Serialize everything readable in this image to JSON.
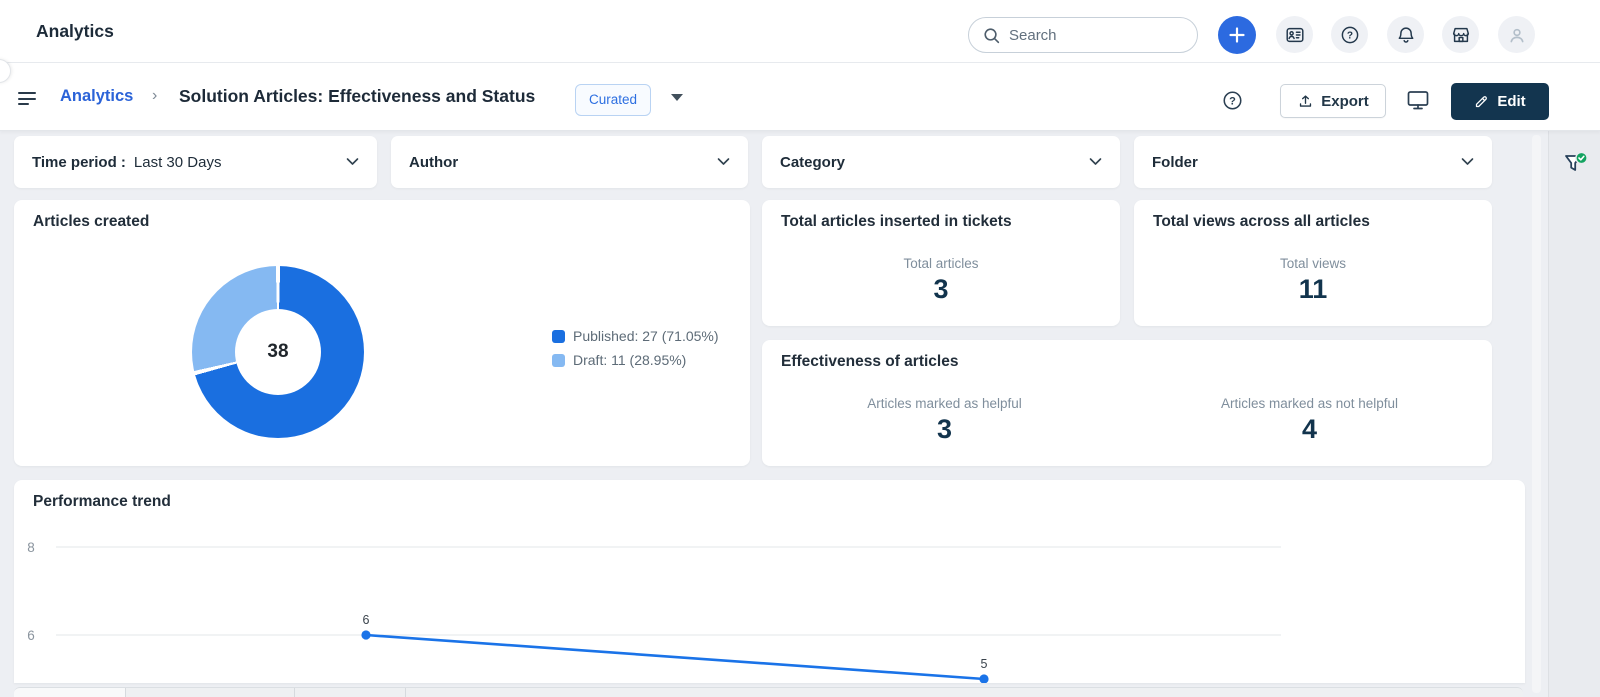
{
  "topbar": {
    "app_title": "Analytics",
    "search_placeholder": "Search"
  },
  "breadcrumb": {
    "section": "Analytics",
    "separator": "›",
    "title": "Solution Articles: Effectiveness and Status",
    "badge": "Curated"
  },
  "toolbar": {
    "export_label": "Export",
    "edit_label": "Edit"
  },
  "filters": {
    "items": [
      {
        "label": "Time period :",
        "value": "Last 30 Days"
      },
      {
        "label": "Author"
      },
      {
        "label": "Category"
      },
      {
        "label": "Folder"
      }
    ]
  },
  "widgets": {
    "articles_created": {
      "title": "Articles created"
    },
    "inserted": {
      "title": "Total articles inserted in tickets",
      "metric_label": "Total articles",
      "value": "3"
    },
    "views": {
      "title": "Total views across all articles",
      "metric_label": "Total views",
      "value": "11"
    },
    "effectiveness": {
      "title": "Effectiveness of articles",
      "stats": [
        {
          "label": "Articles marked as helpful",
          "value": "3"
        },
        {
          "label": "Articles marked as not helpful",
          "value": "4"
        }
      ]
    },
    "performance": {
      "title": "Performance trend"
    }
  },
  "chart_data": [
    {
      "id": "articles-created",
      "type": "pie",
      "subtype": "donut",
      "title": "Articles created",
      "labels": [
        "Published",
        "Draft"
      ],
      "values": [
        27,
        11
      ],
      "percentages": [
        71.05,
        28.95
      ],
      "total": 38,
      "center_label": "38",
      "colors": [
        "#1a6fe0",
        "#85b9f2"
      ],
      "legend": [
        "Published: 27 (71.05%)",
        "Draft: 11 (28.95%)"
      ],
      "legend_position": "right",
      "start_angle_deg": 0,
      "direction": "clockwise"
    },
    {
      "id": "performance-trend",
      "type": "line",
      "title": "Performance trend",
      "series": [
        {
          "name": "",
          "values": [
            6,
            5
          ]
        }
      ],
      "point_labels": [
        "6",
        "5"
      ],
      "y_ticks": [
        6,
        8
      ],
      "x_labels_visible": false,
      "grid": true,
      "line_color": "#1a73e8",
      "tick_color": "#8a949e",
      "grid_color": "#e3e7ea"
    }
  ],
  "colors": {
    "accent_blue": "#2c6ae0",
    "link_blue": "#2b63d8",
    "dark_navy": "#12344d",
    "published": "#1a6fe0",
    "draft": "#85b9f2",
    "trend_line": "#1a73e8",
    "badge_blue": "#2d6fe1",
    "success_green": "#13a360",
    "page_bg": "#edeff3"
  },
  "icons": {
    "search": "magnifier",
    "new_item": "plus",
    "contact_list": "id-card-list",
    "help": "question-mark-circle",
    "notifications": "bell",
    "marketplace": "storefront",
    "profile": "person",
    "nav": "hamburger",
    "breadcrumb_separator": "chevron-right",
    "report_options": "caret-down",
    "filter_chevron": "chevron-down",
    "export": "upload-arrow",
    "present_mode": "monitor",
    "edit": "pencil",
    "filters_status": "funnel-with-check"
  }
}
